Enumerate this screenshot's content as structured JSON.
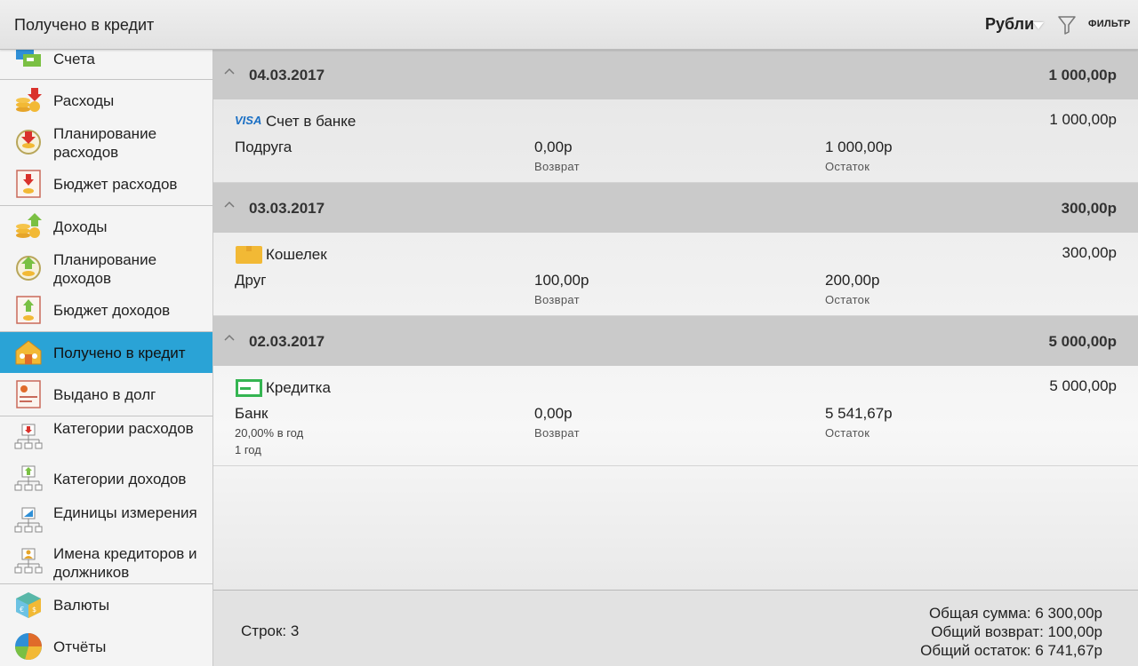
{
  "header": {
    "title": "Получено в кредит",
    "currency": "Рубли",
    "filter_label": "ФИЛЬТР"
  },
  "sidebar": {
    "items": [
      {
        "label": "Счета",
        "icon": "accounts-icon"
      },
      {
        "label": "Расходы",
        "icon": "expenses-icon"
      },
      {
        "label": "Планирование расходов",
        "icon": "expense-planning-icon"
      },
      {
        "label": "Бюджет расходов",
        "icon": "expense-budget-icon"
      },
      {
        "label": "Доходы",
        "icon": "income-icon"
      },
      {
        "label": "Планирование доходов",
        "icon": "income-planning-icon"
      },
      {
        "label": "Бюджет доходов",
        "icon": "income-budget-icon"
      },
      {
        "label": "Получено в кредит",
        "icon": "credit-received-icon"
      },
      {
        "label": "Выдано в долг",
        "icon": "loan-given-icon"
      },
      {
        "label": "Категории расходов",
        "icon": "expense-categories-icon"
      },
      {
        "label": "Категории доходов",
        "icon": "income-categories-icon"
      },
      {
        "label": "Единицы измерения",
        "icon": "units-icon"
      },
      {
        "label": "Имена кредиторов и должников",
        "icon": "creditor-names-icon"
      },
      {
        "label": "Валюты",
        "icon": "currencies-icon"
      },
      {
        "label": "Отчёты",
        "icon": "reports-icon"
      }
    ]
  },
  "groups": [
    {
      "date": "04.03.2017",
      "sum": "1 000,00р",
      "entry": {
        "account_icon": "visa-icon",
        "account_badge": "VISA",
        "account": "Счет в банке",
        "amount": "1 000,00р",
        "person": "Подруга",
        "return_value": "0,00р",
        "return_label": "Возврат",
        "balance_value": "1 000,00р",
        "balance_label": "Остаток"
      }
    },
    {
      "date": "03.03.2017",
      "sum": "300,00р",
      "entry": {
        "account_icon": "wallet-icon",
        "account": "Кошелек",
        "amount": "300,00р",
        "person": "Друг",
        "return_value": "100,00р",
        "return_label": "Возврат",
        "balance_value": "200,00р",
        "balance_label": "Остаток"
      }
    },
    {
      "date": "02.03.2017",
      "sum": "5 000,00р",
      "entry": {
        "account_icon": "credit-card-icon",
        "account": "Кредитка",
        "amount": "5 000,00р",
        "person": "Банк",
        "rate": "20,00% в год",
        "term": "1 год",
        "return_value": "0,00р",
        "return_label": "Возврат",
        "balance_value": "5 541,67р",
        "balance_label": "Остаток"
      }
    }
  ],
  "footer": {
    "rows": "Строк: 3",
    "total_sum": "Общая сумма: 6 300,00р",
    "total_return": "Общий возврат: 100,00р",
    "total_balance": "Общий остаток: 6 741,67р"
  },
  "colors": {
    "accent": "#2aa3d6",
    "group_header": "#cacaca"
  }
}
